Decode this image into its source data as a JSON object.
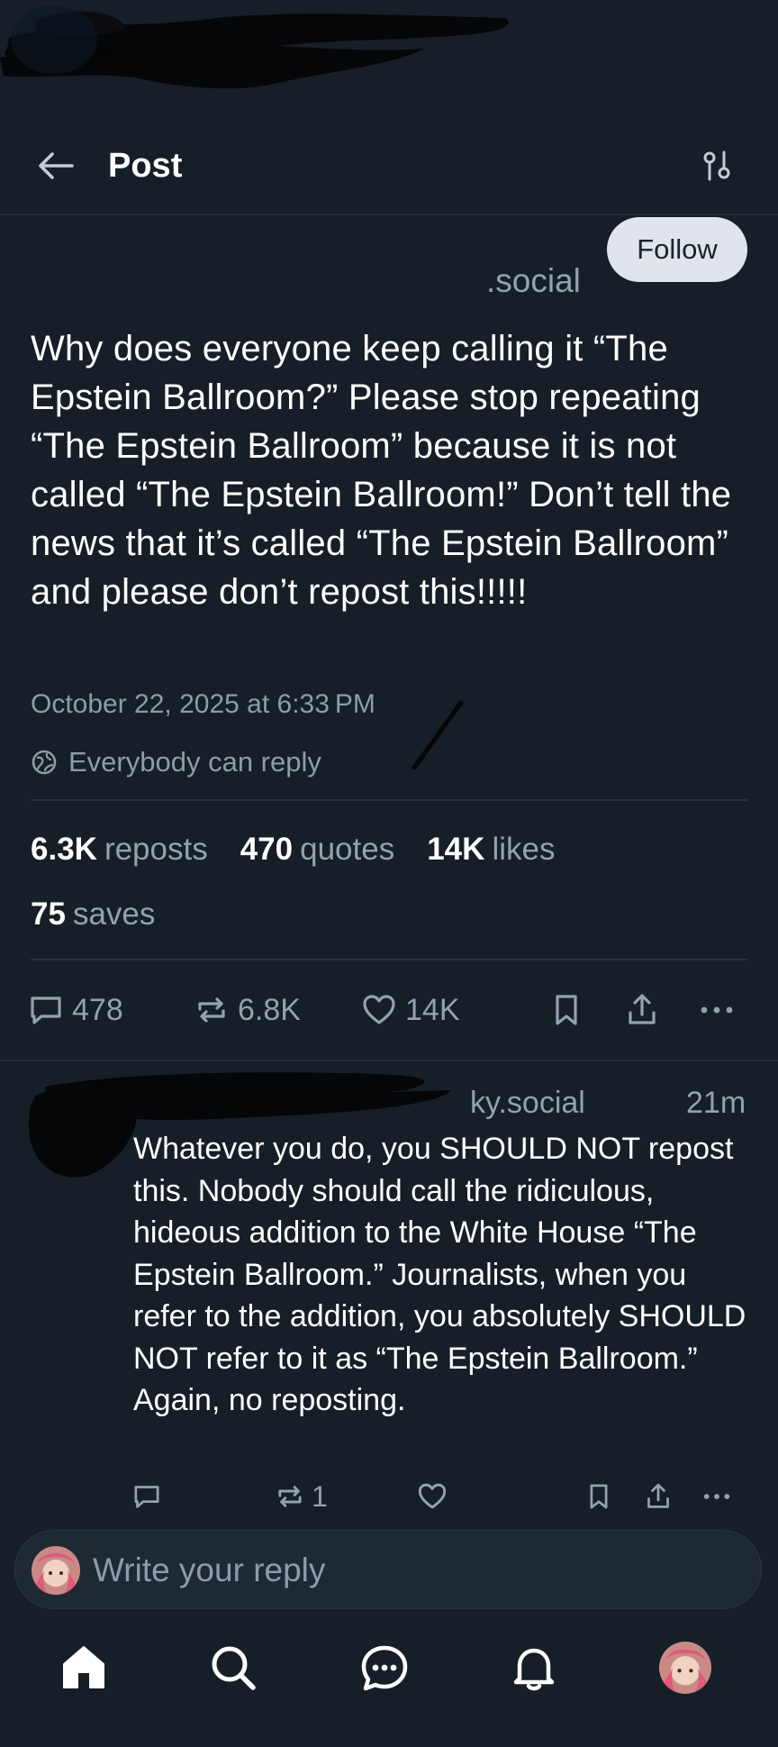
{
  "header": {
    "title": "Post"
  },
  "post": {
    "handle_visible": ".social",
    "follow_label": "Follow",
    "text": "Why does everyone keep calling it “The Epstein Ballroom?” Please stop repeating “The Epstein Ballroom” because it is not called “The Epstein Ballroom!” Don’t tell the news that it’s called “The Epstein Ballroom” and please don’t repost this!!!!!",
    "timestamp": "October 22, 2025 at 6:33 PM",
    "reply_setting": "Everybody can reply",
    "stats": {
      "reposts_num": "6.3K",
      "reposts_label": "reposts",
      "quotes_num": "470",
      "quotes_label": "quotes",
      "likes_num": "14K",
      "likes_label": "likes",
      "saves_num": "75",
      "saves_label": "saves"
    },
    "actions": {
      "replies": "478",
      "reposts": "6.8K",
      "likes": "14K"
    }
  },
  "reply": {
    "handle_visible": "ky.social",
    "time": "21m",
    "text": "Whatever you do, you SHOULD NOT repost this.  Nobody should call the ridiculous, hideous addition to the White House “The Epstein Ballroom.” Journalists, when you refer to the addition, you absolutely SHOULD NOT refer to it as “The Epstein Ballroom.” Again, no reposting.",
    "actions": {
      "reposts": "1"
    }
  },
  "composer": {
    "placeholder": "Write your reply"
  },
  "nav": {
    "items": [
      "home-icon",
      "search-icon",
      "chat-icon",
      "bell-icon",
      "profile-avatar"
    ]
  },
  "colors": {
    "background": "#161e27",
    "muted_text": "#93a1b1",
    "follow_bg": "#dfe5ea"
  }
}
